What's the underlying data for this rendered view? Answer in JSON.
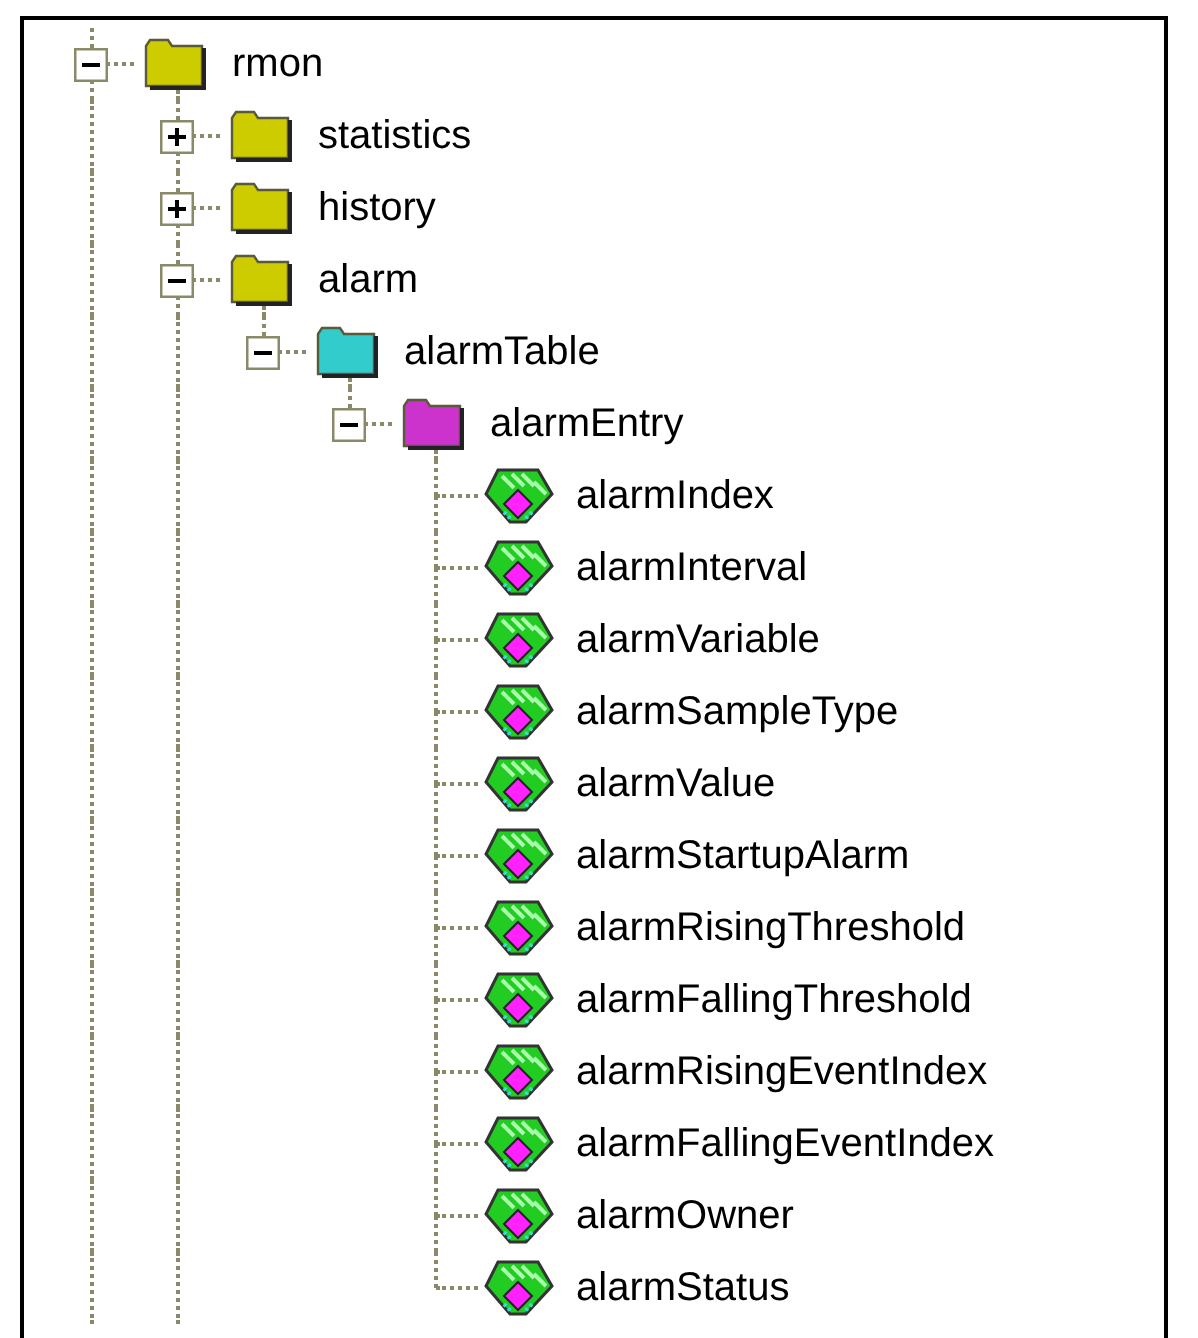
{
  "tree": [
    {
      "label": "rmon",
      "kind": "folder",
      "color": "#cccc00",
      "expanded": true,
      "more_siblings": true,
      "children": [
        {
          "label": "statistics",
          "kind": "folder",
          "color": "#cccc00",
          "expanded": false,
          "more_siblings": true
        },
        {
          "label": "history",
          "kind": "folder",
          "color": "#cccc00",
          "expanded": false,
          "more_siblings": true
        },
        {
          "label": "alarm",
          "kind": "folder",
          "color": "#cccc00",
          "expanded": true,
          "more_siblings": true,
          "children": [
            {
              "label": "alarmTable",
              "kind": "folder",
              "color": "#33cccc",
              "expanded": true,
              "more_siblings": false,
              "children": [
                {
                  "label": "alarmEntry",
                  "kind": "folder",
                  "color": "#cc33cc",
                  "expanded": true,
                  "more_siblings": false,
                  "children": [
                    {
                      "label": "alarmIndex",
                      "kind": "leaf"
                    },
                    {
                      "label": "alarmInterval",
                      "kind": "leaf"
                    },
                    {
                      "label": "alarmVariable",
                      "kind": "leaf"
                    },
                    {
                      "label": "alarmSampleType",
                      "kind": "leaf"
                    },
                    {
                      "label": "alarmValue",
                      "kind": "leaf"
                    },
                    {
                      "label": "alarmStartupAlarm",
                      "kind": "leaf"
                    },
                    {
                      "label": "alarmRisingThreshold",
                      "kind": "leaf"
                    },
                    {
                      "label": "alarmFallingThreshold",
                      "kind": "leaf"
                    },
                    {
                      "label": "alarmRisingEventIndex",
                      "kind": "leaf"
                    },
                    {
                      "label": "alarmFallingEventIndex",
                      "kind": "leaf"
                    },
                    {
                      "label": "alarmOwner",
                      "kind": "leaf"
                    },
                    {
                      "label": "alarmStatus",
                      "kind": "leaf"
                    }
                  ]
                }
              ]
            }
          ]
        }
      ]
    }
  ]
}
